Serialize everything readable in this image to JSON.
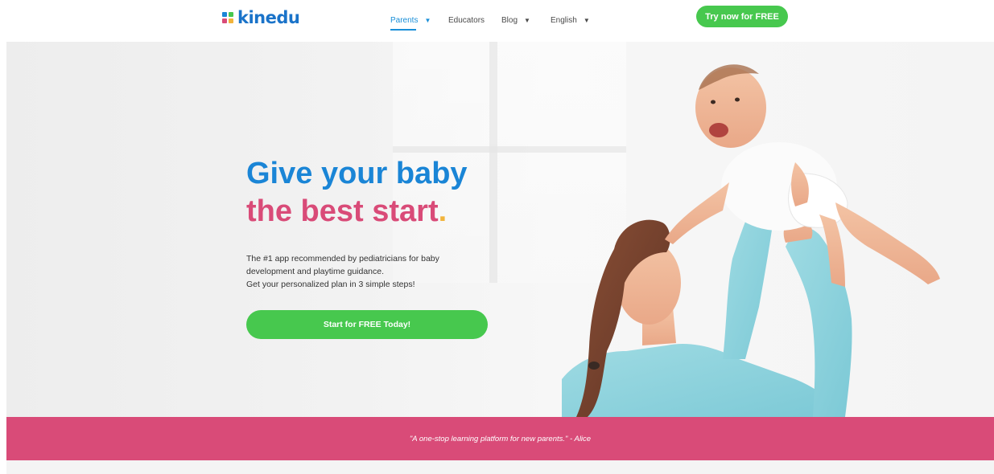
{
  "header": {
    "logo_text": "kinedu",
    "logo_colors": [
      "#1a85d6",
      "#47c84e",
      "#d94b78",
      "#f2b43b"
    ],
    "nav": [
      {
        "label": "Parents",
        "has_dropdown": true,
        "active": true
      },
      {
        "label": "Educators",
        "has_dropdown": false,
        "active": false
      },
      {
        "label": "Blog",
        "has_dropdown": true,
        "active": false
      },
      {
        "label": "English",
        "has_dropdown": true,
        "active": false
      }
    ],
    "cta_label": "Try now for FREE"
  },
  "hero": {
    "headline_line1": "Give your baby",
    "headline_line2": "the best start",
    "headline_dot": ".",
    "subtext_lines": [
      "The #1 app recommended by pediatricians for baby",
      "development and playtime guidance.",
      "Get your personalized plan in 3 simple steps!"
    ],
    "cta_label": "Start for FREE Today!"
  },
  "quote": {
    "text": "\"A one-stop learning platform for new parents.\" - Alice"
  },
  "colors": {
    "brand_blue": "#1a85d6",
    "brand_pink": "#d94b78",
    "brand_green": "#47c84e",
    "accent_yellow": "#f2b43b"
  }
}
